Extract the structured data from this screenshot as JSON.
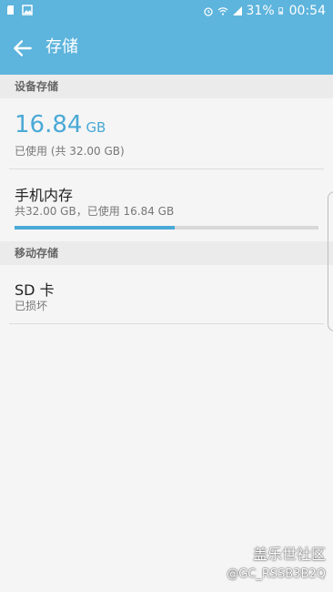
{
  "status_bar": {
    "battery": "31%",
    "time": "00:54"
  },
  "app_bar": {
    "title": "存储"
  },
  "device_storage": {
    "header": "设备存储",
    "total_value": "16.84",
    "total_unit": "GB",
    "used_text": "已使用 (共 32.00 GB)",
    "internal": {
      "title": "手机内存",
      "subtitle": "共32.00 GB，已使用 16.84 GB",
      "usage_fraction": 0.526
    }
  },
  "removable_storage": {
    "header": "移动存储",
    "sd": {
      "title": "SD 卡",
      "subtitle": "已损坏"
    }
  },
  "watermark": {
    "site": "盖乐世社区",
    "tag": "@GC_RSSB3B2Q"
  },
  "colors": {
    "accent": "#5db4dc",
    "value": "#4aa9d6"
  }
}
